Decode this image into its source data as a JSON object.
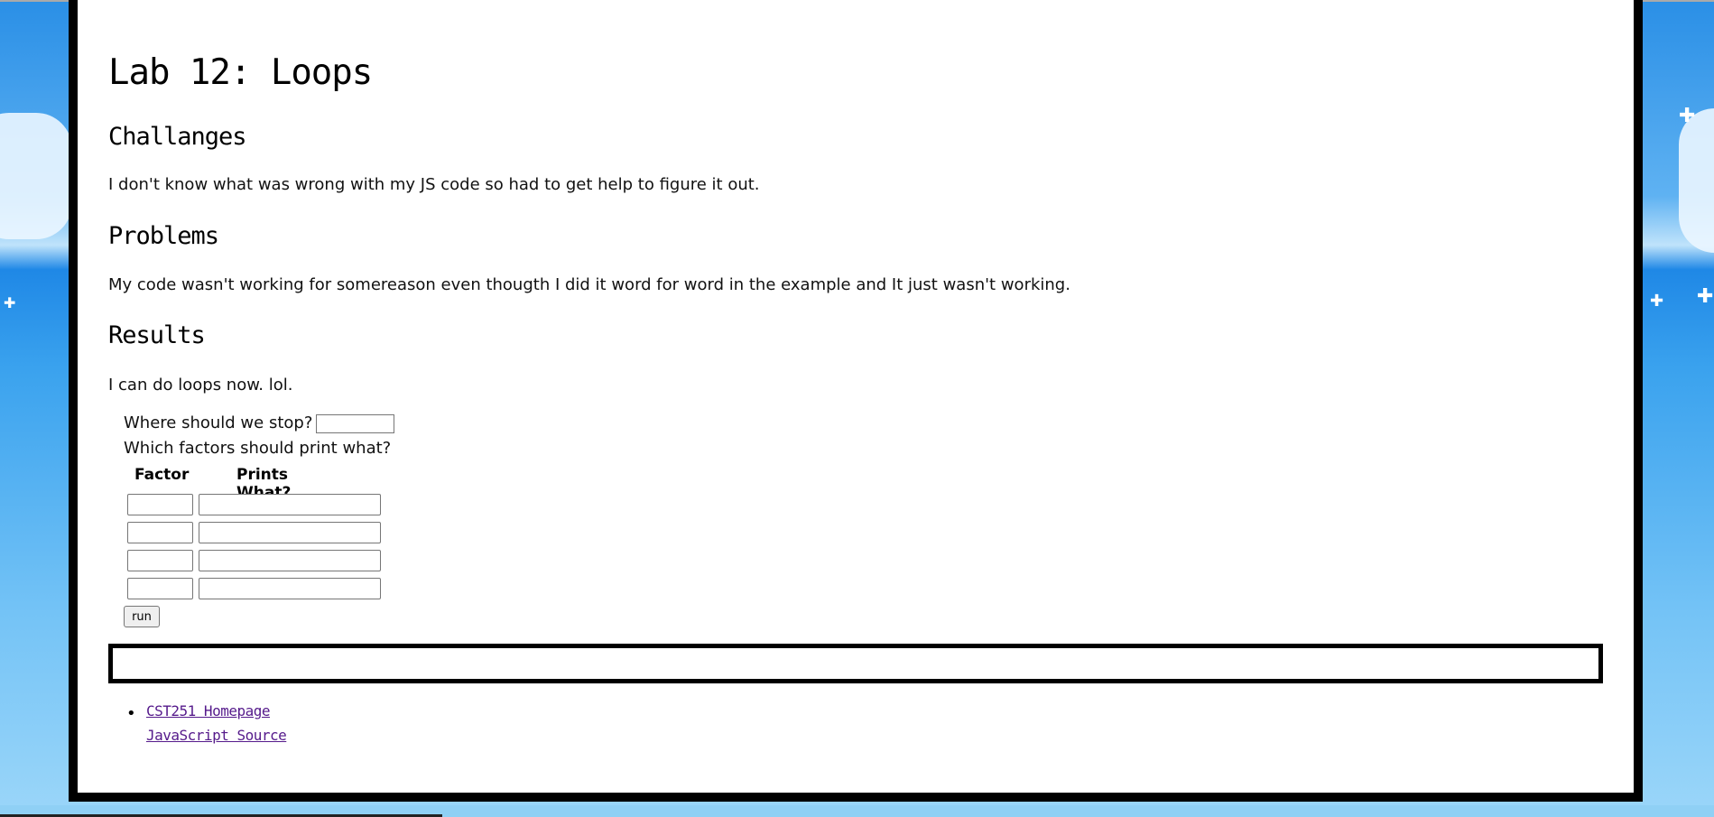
{
  "page": {
    "title": "Lab 12: Loops",
    "sections": {
      "challenges": {
        "heading": "Challanges",
        "text": "I don't know what was wrong with my JS code so had to get help to figure it out."
      },
      "problems": {
        "heading": "Problems",
        "text": "My code wasn't working for somereason even thougth I did it word for word in the example and It just wasn't working."
      },
      "results": {
        "heading": "Results",
        "text": "I can do loops now. lol."
      }
    }
  },
  "form": {
    "stop_label": "Where should we stop?",
    "stop_value": "",
    "factors_label": "Which factors should print what?",
    "table_headers": [
      "Factor",
      "Prints What?"
    ],
    "rows": [
      {
        "factor": "",
        "prints": ""
      },
      {
        "factor": "",
        "prints": ""
      },
      {
        "factor": "",
        "prints": ""
      },
      {
        "factor": "",
        "prints": ""
      }
    ],
    "run_label": "run"
  },
  "output": {
    "text": ""
  },
  "links": [
    {
      "label": "CST251 Homepage"
    },
    {
      "label": "JavaScript Source"
    }
  ],
  "colors": {
    "link_visited": "#551a8b",
    "border": "#000000",
    "background_sky": "#2a8fe6"
  }
}
